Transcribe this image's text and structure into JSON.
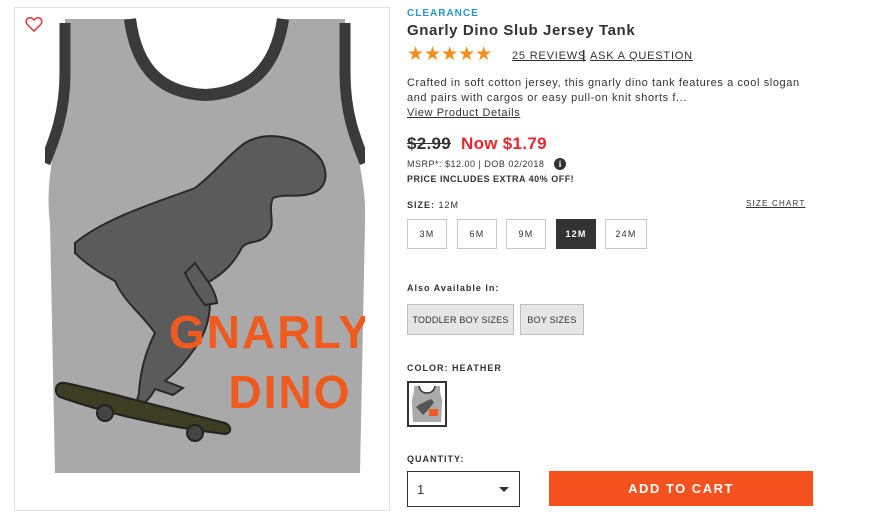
{
  "product": {
    "badge": "CLEARANCE",
    "title": "Gnarly Dino Slub Jersey Tank",
    "rating": 5,
    "stars": "★★★★★",
    "reviews_link": "25 REVIEWS",
    "separator": "|",
    "ask_link": "ASK A QUESTION",
    "description": "Crafted in soft cotton jersey, this gnarly dino tank features a cool slogan and pairs with cargos or easy pull-on knit shorts f...",
    "details_link": "View Product Details"
  },
  "pricing": {
    "old_price": "$2.99",
    "now_price": "Now $1.79",
    "msrp_line": "MSRP*: $12.00 | DOB 02/2018",
    "info_icon_glyph": "i",
    "promo": "PRICE INCLUDES EXTRA 40% OFF!"
  },
  "size": {
    "label": "SIZE:",
    "selected": "12M",
    "chart_link": "SIZE CHART",
    "options": [
      "3M",
      "6M",
      "9M",
      "12M",
      "24M"
    ]
  },
  "also_available": {
    "label": "Also Available In:",
    "options": [
      "TODDLER BOY SIZES",
      "BOY SIZES"
    ]
  },
  "color": {
    "label": "COLOR: HEATHER"
  },
  "quantity": {
    "label": "QUANTITY:",
    "value": "1"
  },
  "cart": {
    "button_label": "ADD TO CART"
  },
  "image": {
    "graphic_text_line1": "GNARLY",
    "graphic_text_line2": "DINO"
  },
  "colors": {
    "accent_orange": "#f4511e",
    "sale_red": "#e8272f",
    "star_orange": "#f28c1b",
    "badge_blue": "#2a97c4",
    "heart_red": "#e8272f"
  },
  "icons": {
    "heart": "heart-icon",
    "info": "info-icon",
    "caret": "chevron-down-icon"
  }
}
